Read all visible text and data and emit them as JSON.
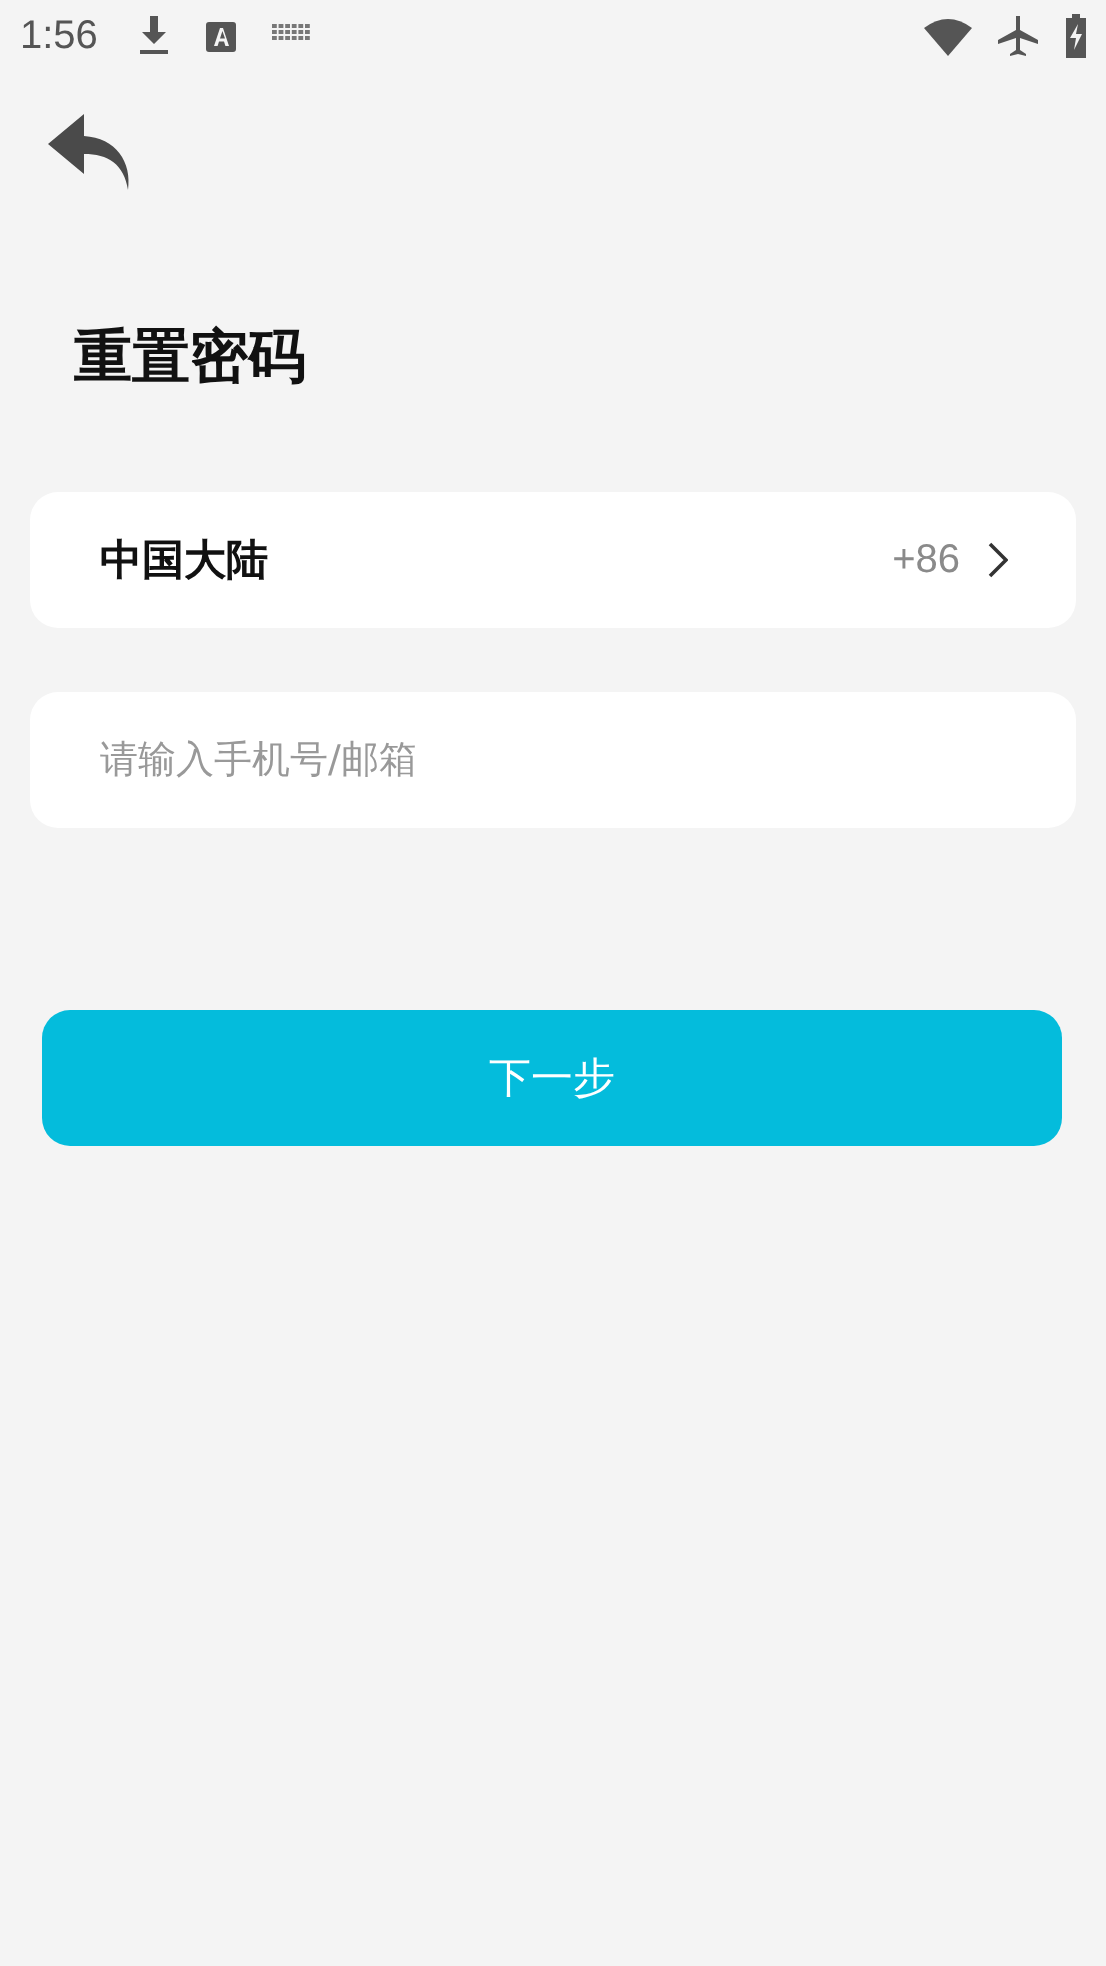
{
  "status_bar": {
    "time": "1:56"
  },
  "title": "重置密码",
  "region": {
    "label": "中国大陆",
    "code": "+86"
  },
  "account_field": {
    "placeholder": "请输入手机号/邮箱"
  },
  "next_button": {
    "label": "下一步"
  }
}
